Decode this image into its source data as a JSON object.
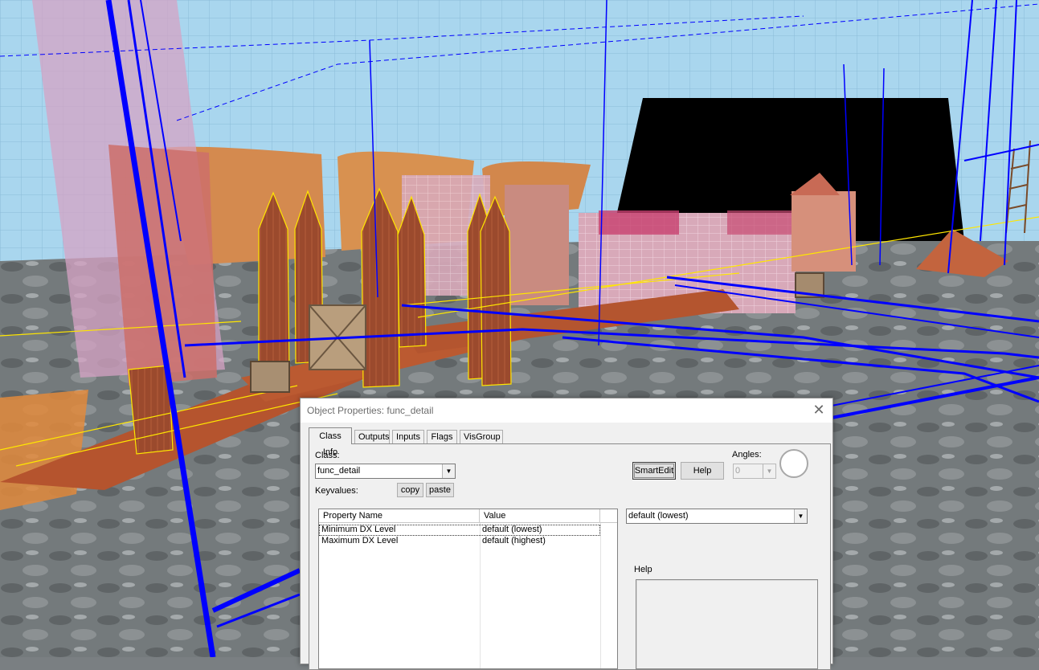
{
  "dialog": {
    "title": "Object Properties: func_detail",
    "tabs": [
      {
        "label": "Class Info",
        "active": true
      },
      {
        "label": "Outputs"
      },
      {
        "label": "Inputs"
      },
      {
        "label": "Flags"
      },
      {
        "label": "VisGroup"
      }
    ],
    "class_label": "Class:",
    "class_value": "func_detail",
    "keyvalues_label": "Keyvalues:",
    "copy_label": "copy",
    "paste_label": "paste",
    "smartedit_label": "SmartEdit",
    "help_button_label": "Help",
    "angles_label": "Angles:",
    "angles_value": "0",
    "columns": {
      "name": "Property Name",
      "value": "Value"
    },
    "rows": [
      {
        "name": "Minimum DX Level",
        "value": "default (lowest)"
      },
      {
        "name": "Maximum DX Level",
        "value": "default (highest)"
      }
    ],
    "value_combo": "default (lowest)",
    "help_label": "Help"
  },
  "colors": {
    "sky": "#a9d3ec",
    "wireframe": "#0000ff",
    "selection_outline": "#ffe600",
    "void": "#000000"
  },
  "icons": [
    "close-icon",
    "dropdown-arrow-icon"
  ]
}
